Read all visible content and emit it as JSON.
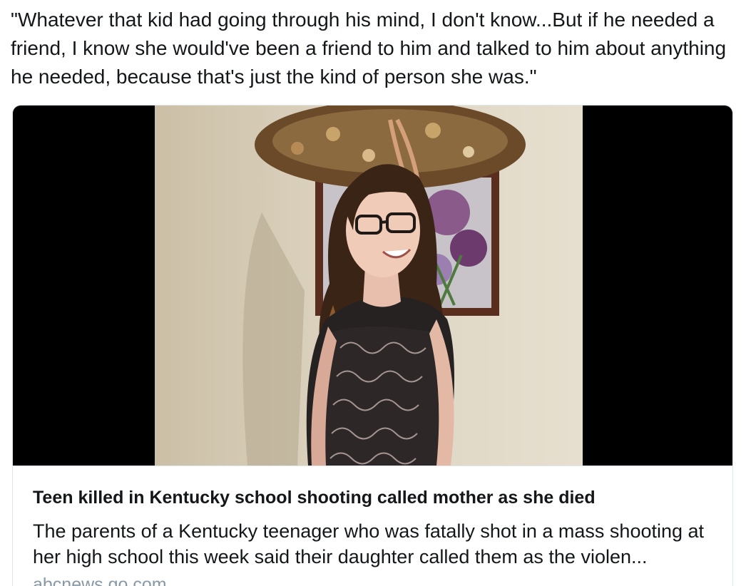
{
  "tweet": {
    "text": "\"Whatever that kid had going through his mind, I don't know...But if he needed a friend, I know she would've been a friend to him and talked to him about anything he needed, because that's just the kind of person she was.\""
  },
  "card": {
    "title": "Teen killed in Kentucky school shooting called mother as she died",
    "description": "The parents of a Kentucky teenager who was fatally shot in a mass shooting at her high school this week said their daughter called them as the violen...",
    "domain": "abcnews.go.com",
    "media": {
      "icon": "photo-of-smiling-teen-girl"
    }
  }
}
